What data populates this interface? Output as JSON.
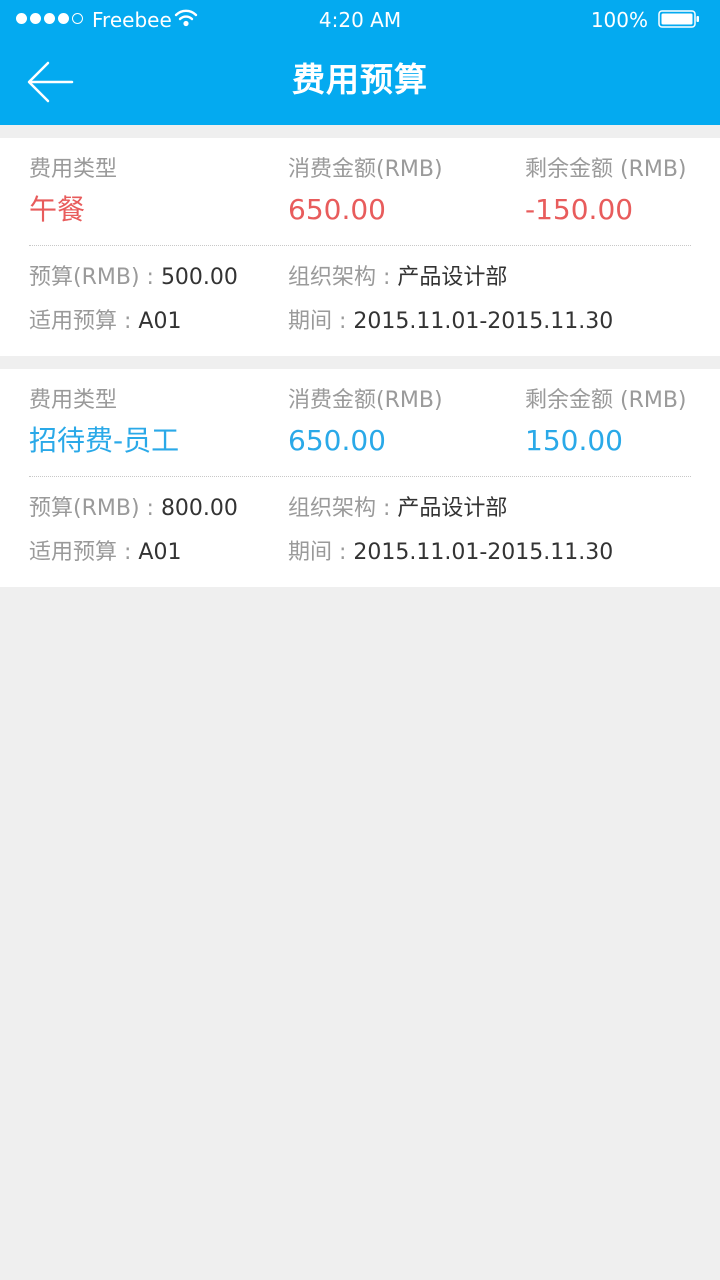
{
  "status_bar": {
    "carrier": "Freebee",
    "time": "4:20 AM",
    "battery": "100%"
  },
  "header": {
    "title": "费用预算"
  },
  "colors": {
    "header_bg": "#04aaf0",
    "negative": "#e85c5c",
    "positive": "#2aa9e8"
  },
  "icons": {
    "back": "back-arrow-icon",
    "wifi": "wifi-icon",
    "battery": "battery-icon",
    "signal": "signal-dots-icon"
  },
  "cards": [
    {
      "expense_type_label": "费用类型",
      "expense_type": "午餐",
      "spent_label": "消费金额(RMB)",
      "spent": "650.00",
      "remaining_label": "剩余金额 (RMB)",
      "remaining": "-150.00",
      "budget_label": "预算(RMB) : ",
      "budget": "500.00",
      "org_label": "组织架构 : ",
      "org": "产品设计部",
      "applicable_label": "适用预算 : ",
      "applicable": "A01",
      "period_label": "期间 : ",
      "period": "2015.11.01-2015.11.30"
    },
    {
      "expense_type_label": "费用类型",
      "expense_type": "招待费-员工",
      "spent_label": "消费金额(RMB)",
      "spent": "650.00",
      "remaining_label": "剩余金额 (RMB)",
      "remaining": "150.00",
      "budget_label": "预算(RMB) : ",
      "budget": "800.00",
      "org_label": "组织架构 : ",
      "org": "产品设计部",
      "applicable_label": "适用预算 : ",
      "applicable": "A01",
      "period_label": "期间 : ",
      "period": "2015.11.01-2015.11.30"
    }
  ]
}
